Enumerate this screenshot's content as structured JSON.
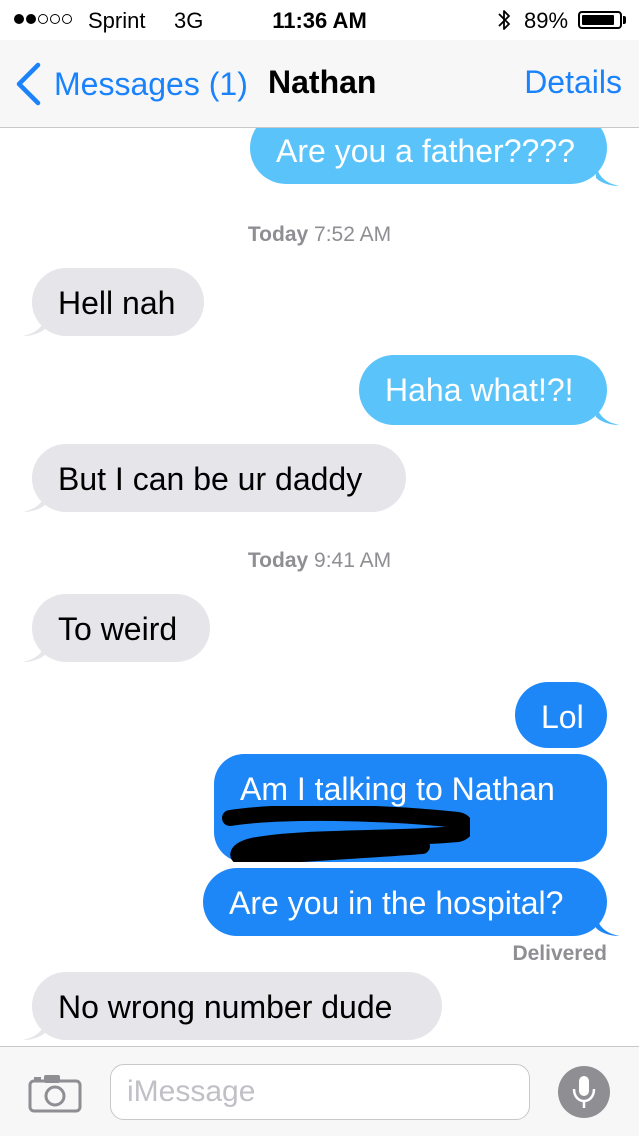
{
  "status_bar": {
    "carrier": "Sprint",
    "network": "3G",
    "time": "11:36 AM",
    "battery": "89%",
    "battery_level": 0.89,
    "signal_bars": 2,
    "signal_max": 5
  },
  "nav": {
    "back_label": "Messages (1)",
    "title": "Nathan",
    "details_label": "Details"
  },
  "colors": {
    "accent": "#1a82fb",
    "incoming_bubble": "#e5e5ea",
    "outgoing_light": "#5ac4fa",
    "outgoing_blue": "#1e87f8"
  },
  "messages": [
    {
      "dir": "out",
      "text": "Are you a father????"
    },
    {
      "dir": "in",
      "text": "Hell nah"
    },
    {
      "dir": "out",
      "text": "Haha what!?!"
    },
    {
      "dir": "in",
      "text": "But I can be ur daddy"
    },
    {
      "dir": "in",
      "text": "To weird"
    },
    {
      "dir": "out",
      "text": "Lol"
    },
    {
      "dir": "out",
      "text": "Am I talking to Nathan"
    },
    {
      "dir": "out",
      "text": "Are you in the hospital?"
    },
    {
      "dir": "in",
      "text": "No wrong number dude"
    }
  ],
  "timestamps": [
    {
      "day": "Today",
      "time": "7:52 AM"
    },
    {
      "day": "Today",
      "time": "9:41 AM"
    }
  ],
  "delivered": "Delivered",
  "input": {
    "placeholder": "iMessage",
    "value": ""
  },
  "icons": {
    "back": "chevron-left-icon",
    "camera": "camera-icon",
    "mic": "microphone-icon",
    "bluetooth": "bluetooth-icon"
  }
}
